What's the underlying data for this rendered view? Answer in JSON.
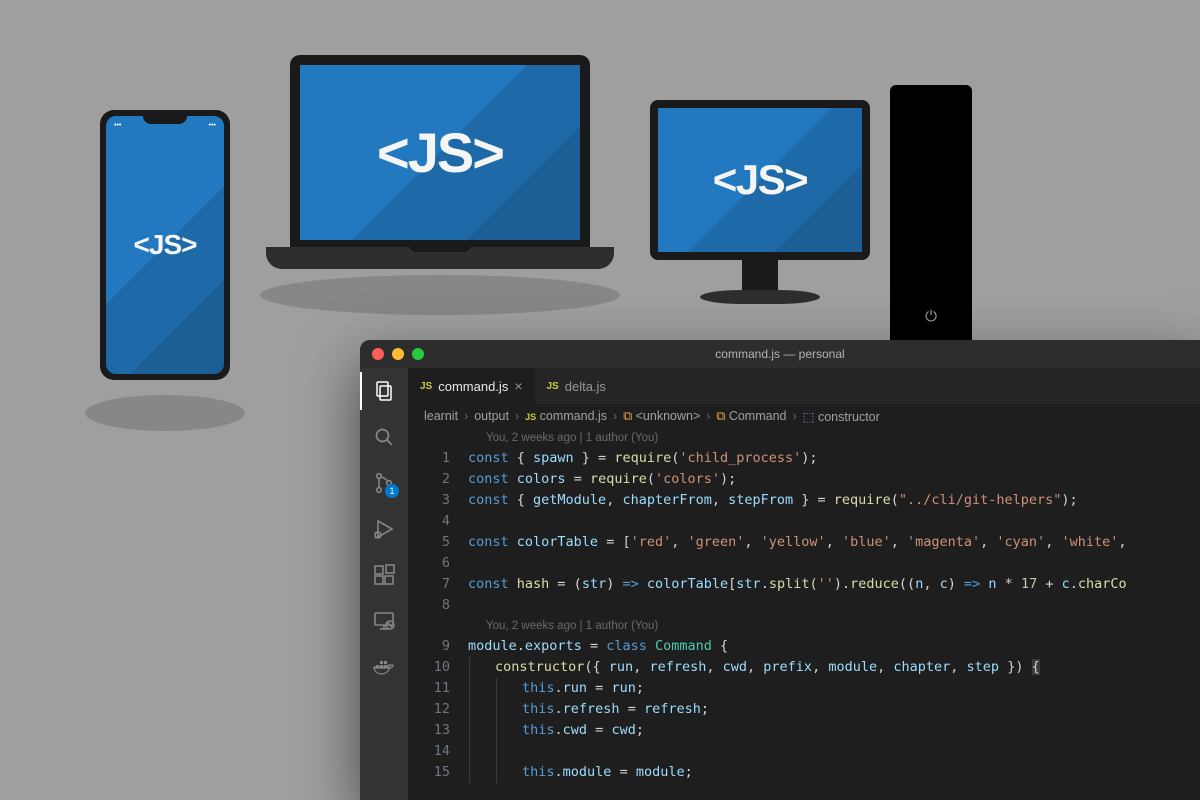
{
  "illustration": {
    "js_label": "<JS>"
  },
  "window": {
    "title": "command.js — personal"
  },
  "activitybar": {
    "items": [
      {
        "name": "explorer",
        "active": true
      },
      {
        "name": "search"
      },
      {
        "name": "source-control",
        "badge": "1"
      },
      {
        "name": "run-debug"
      },
      {
        "name": "extensions"
      },
      {
        "name": "remote"
      },
      {
        "name": "docker"
      }
    ]
  },
  "tabs": [
    {
      "icon": "JS",
      "label": "command.js",
      "active": true,
      "closable": true
    },
    {
      "icon": "JS",
      "label": "delta.js",
      "active": false
    }
  ],
  "breadcrumb": {
    "parts": [
      "learnit",
      "output",
      "command.js",
      "<unknown>",
      "Command",
      "constructor"
    ]
  },
  "codelens": "You, 2 weeks ago | 1 author (You)",
  "code": {
    "lines": [
      {
        "n": 1,
        "tokens": [
          [
            "kw",
            "const"
          ],
          [
            "op",
            " { "
          ],
          [
            "var",
            "spawn"
          ],
          [
            "op",
            " } = "
          ],
          [
            "fn",
            "require"
          ],
          [
            "op",
            "("
          ],
          [
            "str",
            "'child_process'"
          ],
          [
            "op",
            ");"
          ]
        ]
      },
      {
        "n": 2,
        "tokens": [
          [
            "kw",
            "const"
          ],
          [
            "op",
            " "
          ],
          [
            "var",
            "colors"
          ],
          [
            "op",
            " = "
          ],
          [
            "fn",
            "require"
          ],
          [
            "op",
            "("
          ],
          [
            "str",
            "'colors'"
          ],
          [
            "op",
            ");"
          ]
        ]
      },
      {
        "n": 3,
        "tokens": [
          [
            "kw",
            "const"
          ],
          [
            "op",
            " { "
          ],
          [
            "var",
            "getModule"
          ],
          [
            "op",
            ", "
          ],
          [
            "var",
            "chapterFrom"
          ],
          [
            "op",
            ", "
          ],
          [
            "var",
            "stepFrom"
          ],
          [
            "op",
            " } = "
          ],
          [
            "fn",
            "require"
          ],
          [
            "op",
            "("
          ],
          [
            "str",
            "\"../cli/git-helpers\""
          ],
          [
            "op",
            ");"
          ]
        ]
      },
      {
        "n": 4,
        "tokens": []
      },
      {
        "n": 5,
        "tokens": [
          [
            "kw",
            "const"
          ],
          [
            "op",
            " "
          ],
          [
            "var",
            "colorTable"
          ],
          [
            "op",
            " = ["
          ],
          [
            "str",
            "'red'"
          ],
          [
            "op",
            ", "
          ],
          [
            "str",
            "'green'"
          ],
          [
            "op",
            ", "
          ],
          [
            "str",
            "'yellow'"
          ],
          [
            "op",
            ", "
          ],
          [
            "str",
            "'blue'"
          ],
          [
            "op",
            ", "
          ],
          [
            "str",
            "'magenta'"
          ],
          [
            "op",
            ", "
          ],
          [
            "str",
            "'cyan'"
          ],
          [
            "op",
            ", "
          ],
          [
            "str",
            "'white'"
          ],
          [
            "op",
            ","
          ]
        ]
      },
      {
        "n": 6,
        "tokens": []
      },
      {
        "n": 7,
        "tokens": [
          [
            "kw",
            "const"
          ],
          [
            "op",
            " "
          ],
          [
            "fn",
            "hash"
          ],
          [
            "op",
            " = ("
          ],
          [
            "var",
            "str"
          ],
          [
            "op",
            ") "
          ],
          [
            "arrow",
            "=>"
          ],
          [
            "op",
            " "
          ],
          [
            "var",
            "colorTable"
          ],
          [
            "op",
            "["
          ],
          [
            "var",
            "str"
          ],
          [
            "op",
            "."
          ],
          [
            "fn",
            "split"
          ],
          [
            "op",
            "("
          ],
          [
            "str",
            "''"
          ],
          [
            "op",
            ")."
          ],
          [
            "fn",
            "reduce"
          ],
          [
            "op",
            "(("
          ],
          [
            "var",
            "n"
          ],
          [
            "op",
            ", "
          ],
          [
            "var",
            "c"
          ],
          [
            "op",
            ") "
          ],
          [
            "arrow",
            "=>"
          ],
          [
            "op",
            " "
          ],
          [
            "var",
            "n"
          ],
          [
            "op",
            " * "
          ],
          [
            "num",
            "17"
          ],
          [
            "op",
            " + "
          ],
          [
            "var",
            "c"
          ],
          [
            "op",
            "."
          ],
          [
            "fn",
            "charCo"
          ]
        ]
      },
      {
        "n": 8,
        "tokens": []
      }
    ],
    "class_block": {
      "codelens": "You, 2 weeks ago | 1 author (You)",
      "lines": [
        {
          "n": 9,
          "indent": 0,
          "tokens": [
            [
              "var",
              "module"
            ],
            [
              "op",
              "."
            ],
            [
              "var",
              "exports"
            ],
            [
              "op",
              " = "
            ],
            [
              "kw",
              "class"
            ],
            [
              "op",
              " "
            ],
            [
              "mod",
              "Command"
            ],
            [
              "op",
              " {"
            ]
          ]
        },
        {
          "n": 10,
          "indent": 1,
          "tokens": [
            [
              "fn",
              "constructor"
            ],
            [
              "op",
              "({ "
            ],
            [
              "var",
              "run"
            ],
            [
              "op",
              ", "
            ],
            [
              "var",
              "refresh"
            ],
            [
              "op",
              ", "
            ],
            [
              "var",
              "cwd"
            ],
            [
              "op",
              ", "
            ],
            [
              "var",
              "prefix"
            ],
            [
              "op",
              ", "
            ],
            [
              "var",
              "module"
            ],
            [
              "op",
              ", "
            ],
            [
              "var",
              "chapter"
            ],
            [
              "op",
              ", "
            ],
            [
              "var",
              "step"
            ],
            [
              "op",
              " }) "
            ],
            [
              "brace",
              "{"
            ]
          ]
        },
        {
          "n": 11,
          "indent": 2,
          "tokens": [
            [
              "this",
              "this"
            ],
            [
              "op",
              "."
            ],
            [
              "var",
              "run"
            ],
            [
              "op",
              " = "
            ],
            [
              "var",
              "run"
            ],
            [
              "op",
              ";"
            ]
          ]
        },
        {
          "n": 12,
          "indent": 2,
          "tokens": [
            [
              "this",
              "this"
            ],
            [
              "op",
              "."
            ],
            [
              "var",
              "refresh"
            ],
            [
              "op",
              " = "
            ],
            [
              "var",
              "refresh"
            ],
            [
              "op",
              ";"
            ]
          ]
        },
        {
          "n": 13,
          "indent": 2,
          "tokens": [
            [
              "this",
              "this"
            ],
            [
              "op",
              "."
            ],
            [
              "var",
              "cwd"
            ],
            [
              "op",
              " = "
            ],
            [
              "var",
              "cwd"
            ],
            [
              "op",
              ";"
            ]
          ]
        },
        {
          "n": 14,
          "indent": 2,
          "tokens": []
        },
        {
          "n": 15,
          "indent": 2,
          "tokens": [
            [
              "this",
              "this"
            ],
            [
              "op",
              "."
            ],
            [
              "var",
              "module"
            ],
            [
              "op",
              " = "
            ],
            [
              "var",
              "module"
            ],
            [
              "op",
              ";"
            ]
          ]
        }
      ]
    }
  }
}
